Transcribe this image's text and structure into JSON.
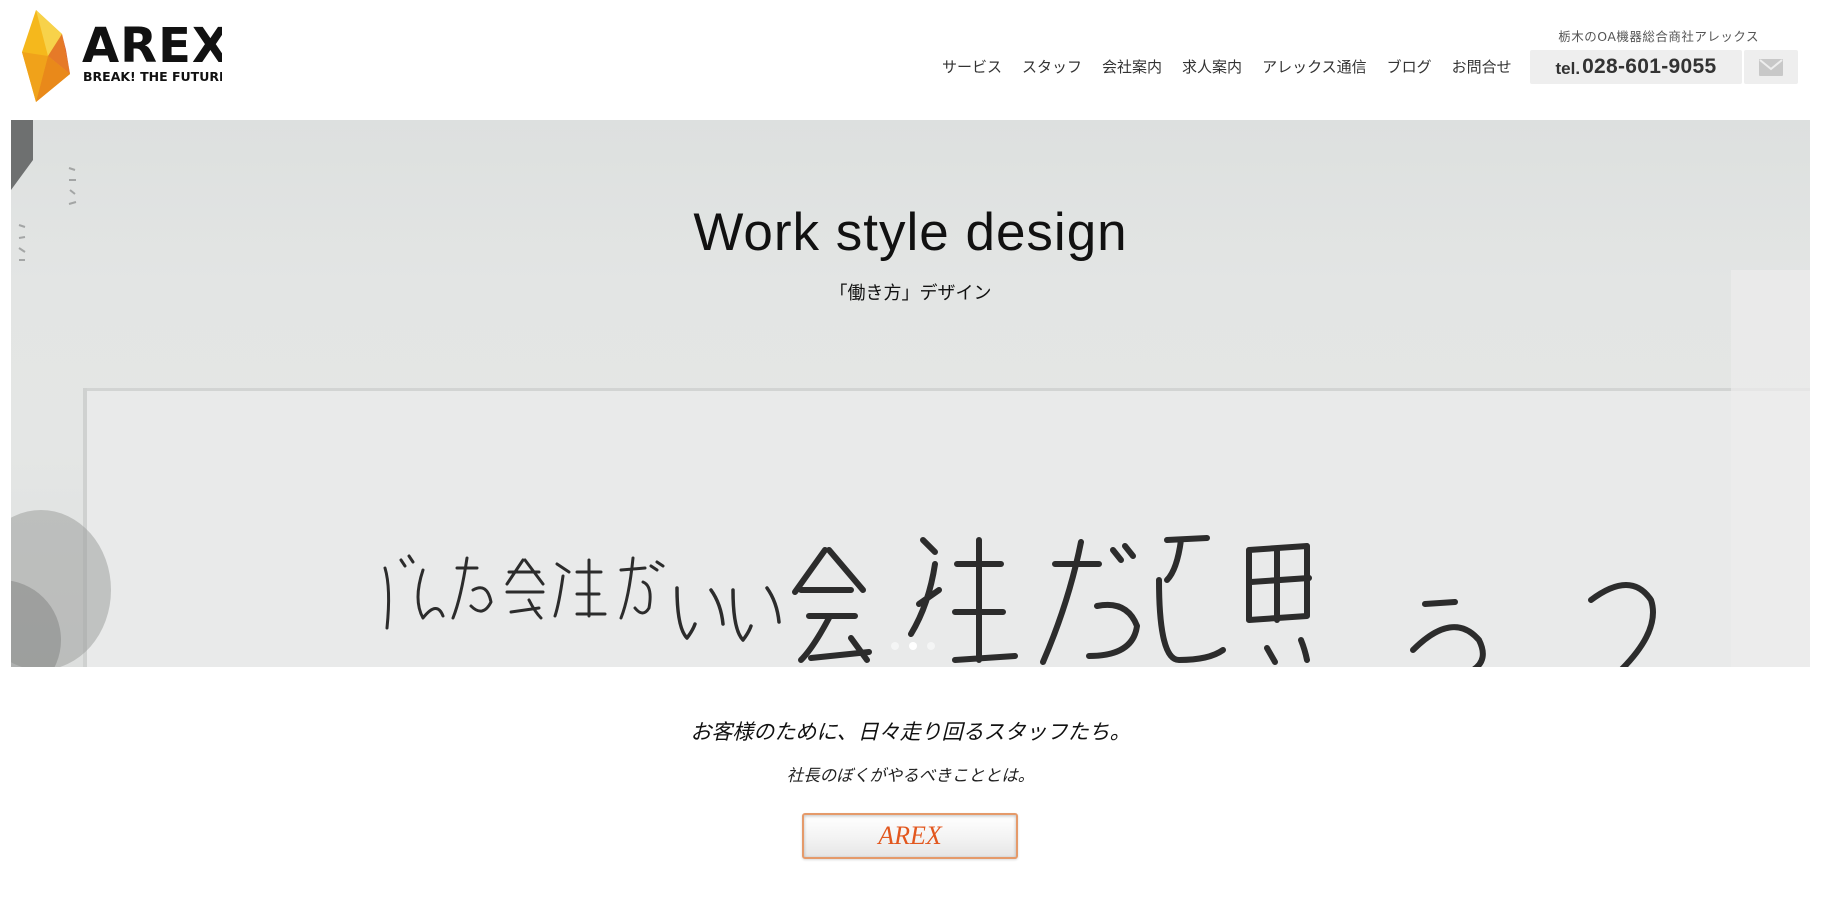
{
  "header": {
    "logo": {
      "name": "AREX",
      "slogan": "BREAK! THE FUTURE"
    },
    "tagline": "栃木のOA機器総合商社アレックス",
    "nav": [
      "サービス",
      "スタッフ",
      "会社案内",
      "求人案内",
      "アレックス通信",
      "ブログ",
      "お問合せ"
    ],
    "tel_prefix": "tel.",
    "tel_number": "028-601-9055",
    "mail_icon": "envelope-icon"
  },
  "hero": {
    "title": "Work style design",
    "subtitle": "「働き方」デザイン",
    "whiteboard_text": "どんな会社がいい会社だと思う?",
    "slides": 3,
    "active_slide": 2
  },
  "intro": {
    "title": "お客様のために、日々走り回るスタッフたち。",
    "subtitle": "社長のぼくがやるべきこととは。",
    "button_label": "AREX"
  },
  "colors": {
    "brand_orange": "#e2571e",
    "logo_yellow": "#f5c21b",
    "button_border": "#e59a6a",
    "tel_background": "#eeeeee"
  }
}
